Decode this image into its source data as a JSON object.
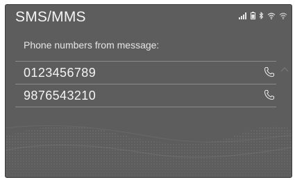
{
  "header": {
    "title": "SMS/MMS",
    "status_icons": [
      "signal-bars-icon",
      "battery-icon",
      "bluetooth-icon",
      "wifi-icon",
      "wifi-secondary-icon"
    ]
  },
  "list": {
    "heading": "Phone numbers from message:",
    "items": [
      {
        "number": "0123456789",
        "action_icon": "phone-icon"
      },
      {
        "number": "9876543210",
        "action_icon": "phone-icon"
      }
    ]
  },
  "scroll": {
    "up_icon": "chevron-up-icon"
  },
  "colors": {
    "screen_bg": "#5d5d5d",
    "text": "#f4f4f4",
    "divider": "#8c8c8c"
  }
}
